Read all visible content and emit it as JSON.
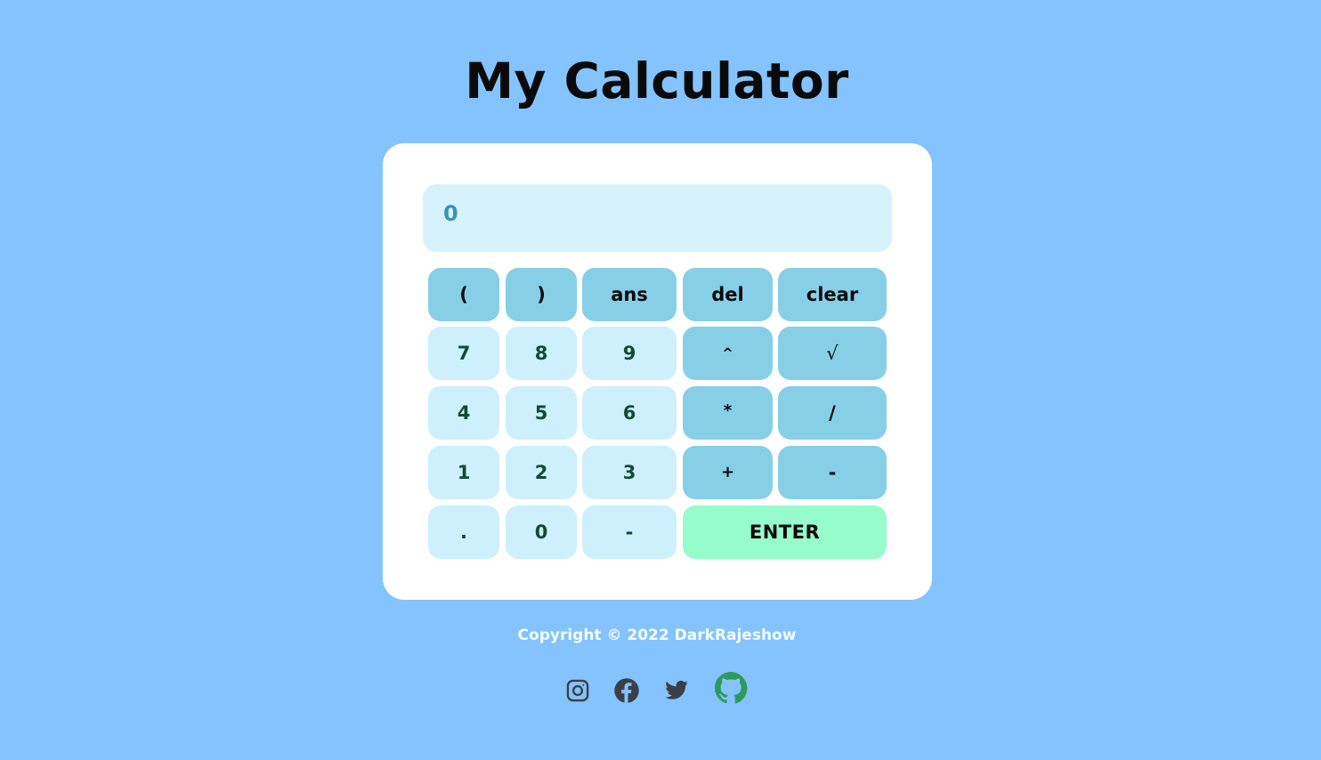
{
  "header": {
    "title": "My Calculator"
  },
  "calculator": {
    "display": "0",
    "keys": {
      "open_paren": "(",
      "close_paren": ")",
      "ans": "ans",
      "del": "del",
      "clear": "clear",
      "seven": "7",
      "eight": "8",
      "nine": "9",
      "power": "^",
      "sqrt": "√",
      "four": "4",
      "five": "5",
      "six": "6",
      "multiply": "*",
      "divide": "/",
      "one": "1",
      "two": "2",
      "three": "3",
      "plus": "+",
      "minus": "-",
      "decimal": ".",
      "zero": "0",
      "negate": "-",
      "enter": "ENTER"
    }
  },
  "footer": {
    "copyright": "Copyright © 2022 DarkRajeshow",
    "socials": [
      {
        "icon": "instagram-icon",
        "color": "#3b3f45"
      },
      {
        "icon": "facebook-icon",
        "color": "#3b3f45"
      },
      {
        "icon": "twitter-icon",
        "color": "#3b3f45"
      },
      {
        "icon": "github-icon",
        "color": "#2e9a5a"
      }
    ]
  },
  "colors": {
    "background": "#84c3fd",
    "card": "#ffffff",
    "display_bg": "#d6f3fd",
    "display_text": "#3c91b4",
    "number_key": "#cdf0fc",
    "operator_key": "#86cfe7",
    "enter_key": "#97fccc"
  }
}
